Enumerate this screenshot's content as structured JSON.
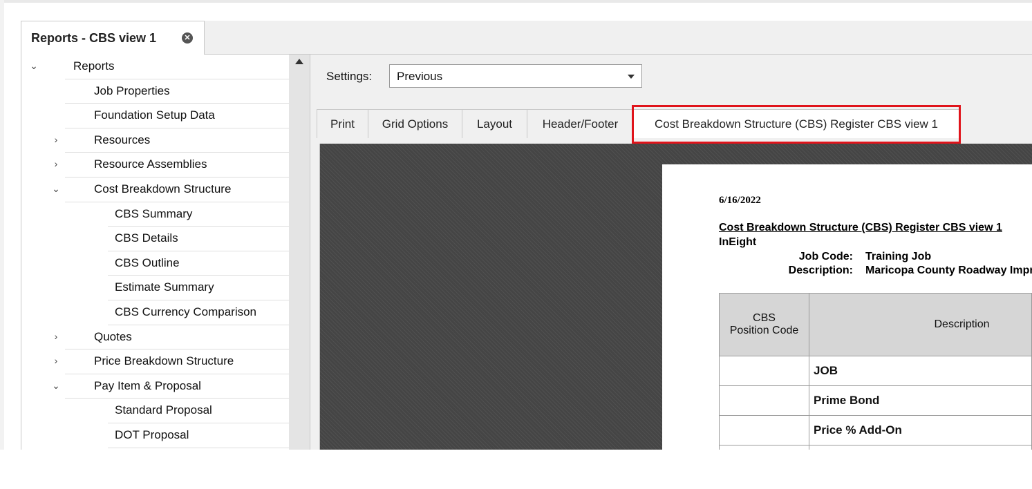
{
  "window": {
    "doc_tab_title": "Reports - CBS view 1",
    "close_glyph": "✕"
  },
  "tree": {
    "rows": [
      {
        "label": "Reports",
        "expander": "⌄",
        "icon": "none",
        "level": "root"
      },
      {
        "label": "Job Properties",
        "expander": "",
        "icon": "folder-icon",
        "level": "1"
      },
      {
        "label": "Foundation Setup Data",
        "expander": "",
        "icon": "setup-icon",
        "level": "1"
      },
      {
        "label": "Resources",
        "expander": "›",
        "icon": "worker-icon",
        "level": "1"
      },
      {
        "label": "Resource Assemblies",
        "expander": "›",
        "icon": "assembly-icon",
        "level": "1"
      },
      {
        "label": "Cost Breakdown Structure",
        "expander": "⌄",
        "icon": "hierarchy-icon",
        "level": "1"
      },
      {
        "label": "CBS Summary",
        "expander": "",
        "icon": "none",
        "level": "2"
      },
      {
        "label": "CBS Details",
        "expander": "",
        "icon": "none",
        "level": "2"
      },
      {
        "label": "CBS Outline",
        "expander": "",
        "icon": "none",
        "level": "2"
      },
      {
        "label": "Estimate Summary",
        "expander": "",
        "icon": "none",
        "level": "2"
      },
      {
        "label": "CBS Currency Comparison",
        "expander": "",
        "icon": "none",
        "level": "2"
      },
      {
        "label": "Quotes",
        "expander": "›",
        "icon": "quotes-icon",
        "level": "1"
      },
      {
        "label": "Price Breakdown Structure",
        "expander": "›",
        "icon": "price-breakdown-icon",
        "level": "1"
      },
      {
        "label": "Pay Item & Proposal",
        "expander": "⌄",
        "icon": "document-icon",
        "level": "1"
      },
      {
        "label": "Standard Proposal",
        "expander": "",
        "icon": "none",
        "level": "2"
      },
      {
        "label": "DOT Proposal",
        "expander": "",
        "icon": "none",
        "level": "2"
      }
    ]
  },
  "settings": {
    "label": "Settings:",
    "value": "Previous"
  },
  "tabs": [
    {
      "label": "Print"
    },
    {
      "label": "Grid Options"
    },
    {
      "label": "Layout"
    },
    {
      "label": "Header/Footer"
    },
    {
      "label": "Cost Breakdown Structure (CBS) Register CBS view 1"
    }
  ],
  "report": {
    "date": "6/16/2022",
    "title": "Cost Breakdown Structure (CBS) Register CBS view 1",
    "company": "InEight",
    "job_code_label": "Job Code:",
    "job_code_value": "Training Job",
    "description_label": "Description:",
    "description_value": "Maricopa County Roadway Improvements",
    "table": {
      "header_code_line1": "CBS",
      "header_code_line2": "Position Code",
      "header_desc": "Description",
      "rows": [
        {
          "code": "",
          "desc": "JOB"
        },
        {
          "code": "",
          "desc": "Prime Bond"
        },
        {
          "code": "",
          "desc": "Price % Add-On"
        }
      ]
    }
  },
  "colors": {
    "highlight": "#e0141b",
    "preview_bg": "#454545"
  }
}
